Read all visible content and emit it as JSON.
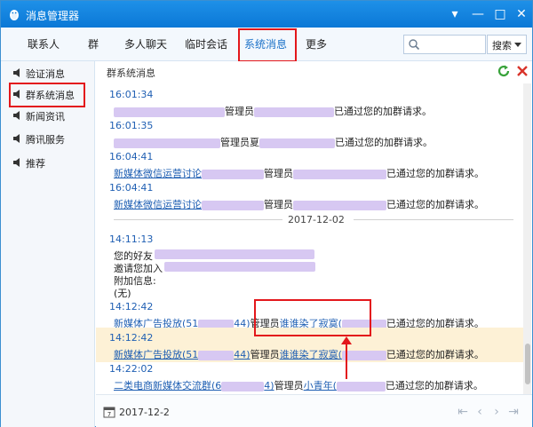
{
  "window": {
    "title": "消息管理器",
    "controls": [
      "▾",
      "—",
      "□",
      "✕"
    ]
  },
  "tabs": [
    {
      "label": "联系人"
    },
    {
      "label": "群"
    },
    {
      "label": "多人聊天"
    },
    {
      "label": "临时会话"
    },
    {
      "label": "系统消息",
      "active": true
    },
    {
      "label": "更多"
    }
  ],
  "search": {
    "placeholder": "",
    "scope_label": "搜索"
  },
  "sidebar": {
    "items": [
      {
        "label": "验证消息",
        "icon": "speaker-icon"
      },
      {
        "label": "群系统消息",
        "icon": "speaker-icon",
        "selected": true
      },
      {
        "label": "新闻资讯",
        "icon": "speaker-icon"
      },
      {
        "label": "腾讯服务",
        "icon": "speaker-icon"
      },
      {
        "label": "推荐",
        "icon": "speaker-icon"
      }
    ]
  },
  "content": {
    "header": "群系统消息",
    "messages": [
      {
        "time": "16:01:34",
        "text_before": "管理员",
        "text_after": "已通过您的加群请求。"
      },
      {
        "time": "16:01:35",
        "text_before": "管理员夏",
        "text_after": "已通过您的加群请求。"
      },
      {
        "time": "16:04:41",
        "group": "新媒体微信运营讨论",
        "text_before": "管理员",
        "text_after": "已通过您的加群请求。"
      },
      {
        "time": "16:04:41",
        "group": "新媒体微信运营讨论",
        "text_before": "管理员",
        "text_after": "已通过您的加群请求。"
      },
      {
        "date_separator": "2017-12-02"
      },
      {
        "time": "14:11:13",
        "lines": [
          "您的好友",
          "邀请您加入",
          "附加信息:",
          "(无)"
        ]
      },
      {
        "time": "14:12:42",
        "group": "新媒体广告投放(51",
        "group_suffix": "44)",
        "text_before": "管理员",
        "admin": "谁谁染了寂寞(",
        "text_after": "已通过您的加群请求。"
      },
      {
        "time": "14:12:42",
        "group": "新媒体广告投放(51",
        "group_suffix": "44)",
        "text_before": "管理员",
        "admin": "谁谁染了寂寞(",
        "text_after": "已通过您的加群请求。",
        "highlighted": true
      },
      {
        "time": "14:22:02",
        "group": "二类电商新媒体交流群(6",
        "group_suffix": "4)",
        "text_before": "管理员",
        "admin": "小青年(",
        "text_after": "已通过您的加群请求。"
      }
    ]
  },
  "footer": {
    "date": "2017-12-2"
  },
  "colors": {
    "title_bar": "#0b78d6",
    "link": "#1f5fb3",
    "annotation": "#e3171b",
    "highlight_row": "#fdf1d6",
    "blurred": "#d7c8f2"
  }
}
